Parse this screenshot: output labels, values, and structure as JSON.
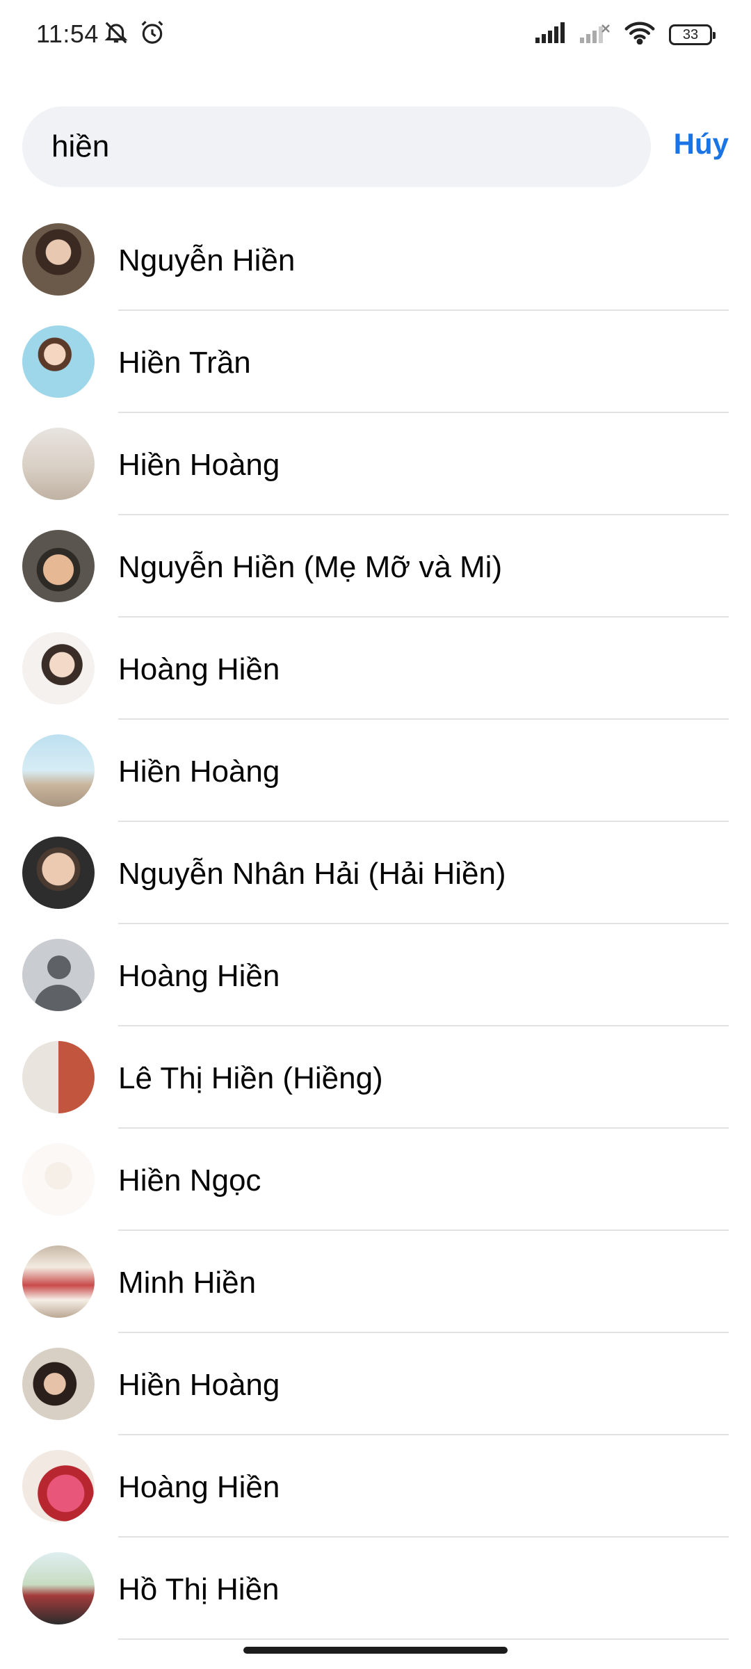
{
  "status_bar": {
    "time": "11:54",
    "battery": "33",
    "icons": [
      "mute-icon",
      "alarm-icon",
      "signal-icon",
      "signal-no-sim-icon",
      "wifi-icon",
      "battery-icon"
    ]
  },
  "search": {
    "value": "hiền",
    "cancel_label": "Húy"
  },
  "results": [
    {
      "name": "Nguyễn Hiền",
      "avatar": "photo"
    },
    {
      "name": "Hiền Trần",
      "avatar": "photo"
    },
    {
      "name": "Hiền Hoàng",
      "avatar": "photo"
    },
    {
      "name": "Nguyễn Hiền (Mẹ Mỡ và Mi)",
      "avatar": "photo"
    },
    {
      "name": "Hoàng Hiền",
      "avatar": "photo"
    },
    {
      "name": "Hiền Hoàng",
      "avatar": "photo"
    },
    {
      "name": "Nguyễn Nhân Hải (Hải Hiền)",
      "avatar": "photo"
    },
    {
      "name": "Hoàng Hiền",
      "avatar": "default"
    },
    {
      "name": "Lê Thị Hiền (Hiềng)",
      "avatar": "photo"
    },
    {
      "name": "Hiền Ngọc",
      "avatar": "photo"
    },
    {
      "name": "Minh Hiền",
      "avatar": "photo"
    },
    {
      "name": "Hiền Hoàng",
      "avatar": "photo"
    },
    {
      "name": "Hoàng Hiền",
      "avatar": "photo"
    },
    {
      "name": "Hồ Thị Hiền",
      "avatar": "photo"
    }
  ],
  "colors": {
    "accent": "#1b74e4",
    "search_bg": "#f0f2f5",
    "divider": "#e2e2e2",
    "text": "#050505"
  }
}
